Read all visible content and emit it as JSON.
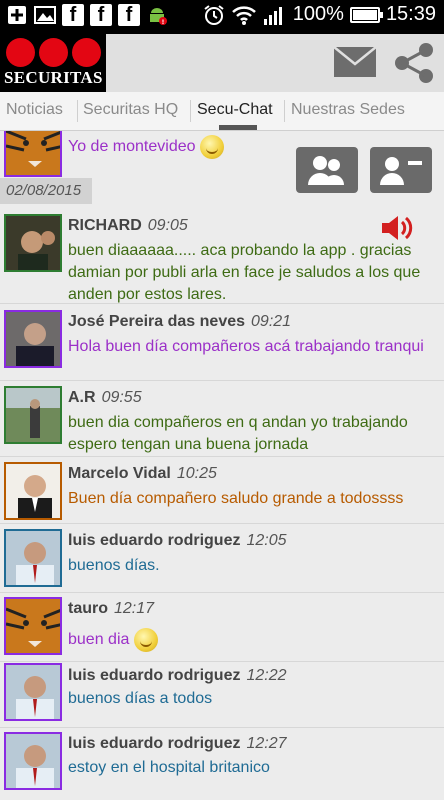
{
  "status_bar": {
    "battery": "100%",
    "time": "15:39"
  },
  "header": {
    "logo_text": "SECURITAS"
  },
  "tabs": [
    {
      "label": "Noticias",
      "active": false
    },
    {
      "label": "Securitas HQ",
      "active": false
    },
    {
      "label": "Secu-Chat",
      "active": true
    },
    {
      "label": "Nuestras Sedes",
      "active": false
    }
  ],
  "chat": {
    "top_message": "Yo de montevideo",
    "date": "02/08/2015",
    "messages": [
      {
        "name": "RICHARD",
        "time": "09:05",
        "text": "buen diaaaaaa..... aca probando la app . gracias damian por publi arla en face je saludos a los que anden por estos lares.",
        "color": "#3e6b14",
        "has_audio_icon": true
      },
      {
        "name": "José Pereira das neves",
        "time": "09:21",
        "text": "Hola buen día compañeros acá trabajando tranqui",
        "color": "#9b30c8"
      },
      {
        "name": "A.R",
        "time": "09:55",
        "text": "buen dia compañeros en q andan yo trabajando espero tengan una buena jornada",
        "color": "#3e6b14"
      },
      {
        "name": "Marcelo Vidal",
        "time": "10:25",
        "text": "Buen día compañero saludo grande a todossss",
        "color": "#b75b00"
      },
      {
        "name": "luis eduardo rodriguez",
        "time": "12:05",
        "text": "buenos días.",
        "color": "#1f6b94"
      },
      {
        "name": "tauro",
        "time": "12:17",
        "text": "buen dia",
        "color": "#9b30c8"
      },
      {
        "name": "luis eduardo rodriguez",
        "time": "12:22",
        "text": "buenos días a todos",
        "color": "#1f6b94"
      },
      {
        "name": "luis eduardo rodriguez",
        "time": "12:27",
        "text": "estoy en el hospital britanico",
        "color": "#1f6b94"
      }
    ]
  },
  "colors": {
    "brand_red": "#e30613",
    "green": "#3e6b14",
    "purple": "#9b30c8",
    "orange": "#b75b00",
    "blue": "#1f6b94"
  },
  "icons": [
    "add-icon",
    "image-icon",
    "facebook-icon",
    "android-icon",
    "alarm-icon",
    "wifi-icon",
    "signal-icon",
    "battery-icon",
    "mail-icon",
    "share-icon",
    "group-icon",
    "contact-card-icon",
    "speaker-icon",
    "smiley-icon"
  ]
}
